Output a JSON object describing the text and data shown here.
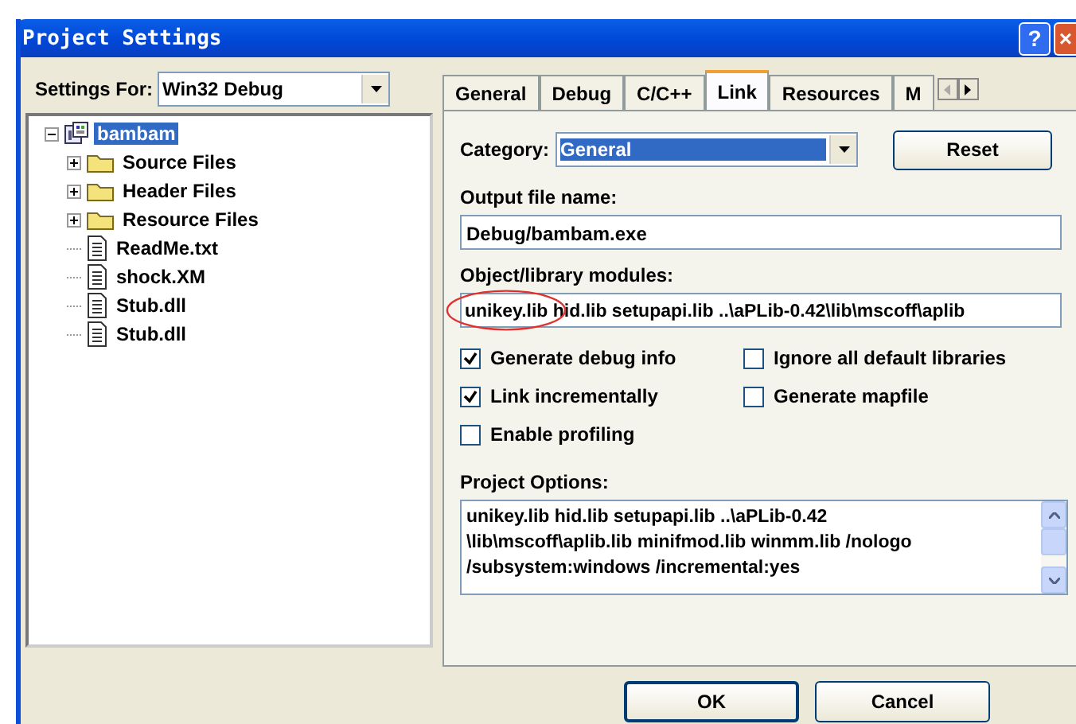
{
  "window": {
    "title": "Project Settings",
    "help_button": "?",
    "close_button": "×"
  },
  "settings_for": {
    "label": "Settings For:",
    "value": "Win32 Debug"
  },
  "tree": [
    {
      "label": "bambam",
      "kind": "project",
      "selected": true,
      "expanded": true,
      "children": [
        {
          "label": "Source Files",
          "kind": "folder",
          "selected": false,
          "expanded": false
        },
        {
          "label": "Header Files",
          "kind": "folder",
          "selected": false,
          "expanded": false
        },
        {
          "label": "Resource Files",
          "kind": "folder",
          "selected": false,
          "expanded": false
        },
        {
          "label": "ReadMe.txt",
          "kind": "file",
          "selected": false
        },
        {
          "label": "shock.XM",
          "kind": "file",
          "selected": false
        },
        {
          "label": "Stub.dll",
          "kind": "file",
          "selected": false
        },
        {
          "label": "Stub.dll",
          "kind": "file",
          "selected": false
        }
      ]
    }
  ],
  "tabs": [
    {
      "label": "General",
      "selected": false
    },
    {
      "label": "Debug",
      "selected": false
    },
    {
      "label": "C/C++",
      "selected": false
    },
    {
      "label": "Link",
      "selected": true
    },
    {
      "label": "Resources",
      "selected": false
    },
    {
      "label": "M",
      "selected": false
    }
  ],
  "category": {
    "label": "Category:",
    "value": "General"
  },
  "reset_button": "Reset",
  "output_file": {
    "label": "Output file name:",
    "value": "Debug/bambam.exe"
  },
  "modules": {
    "label": "Object/library modules:",
    "value": "unikey.lib hid.lib setupapi.lib ..\\aPLib-0.42\\lib\\mscoff\\aplib"
  },
  "checkboxes": [
    {
      "label": "Generate debug info",
      "checked": true
    },
    {
      "label": "Ignore all default libraries",
      "checked": false
    },
    {
      "label": "Link incrementally",
      "checked": true
    },
    {
      "label": "Generate mapfile",
      "checked": false
    },
    {
      "label": "Enable profiling",
      "checked": false
    }
  ],
  "project_options": {
    "label": "Project Options:",
    "lines": [
      "unikey.lib hid.lib setupapi.lib ..\\aPLib-0.42",
      "\\lib\\mscoff\\aplib.lib minifmod.lib winmm.lib /nologo",
      "/subsystem:windows /incremental:yes"
    ]
  },
  "buttons": [
    "OK",
    "Cancel"
  ]
}
